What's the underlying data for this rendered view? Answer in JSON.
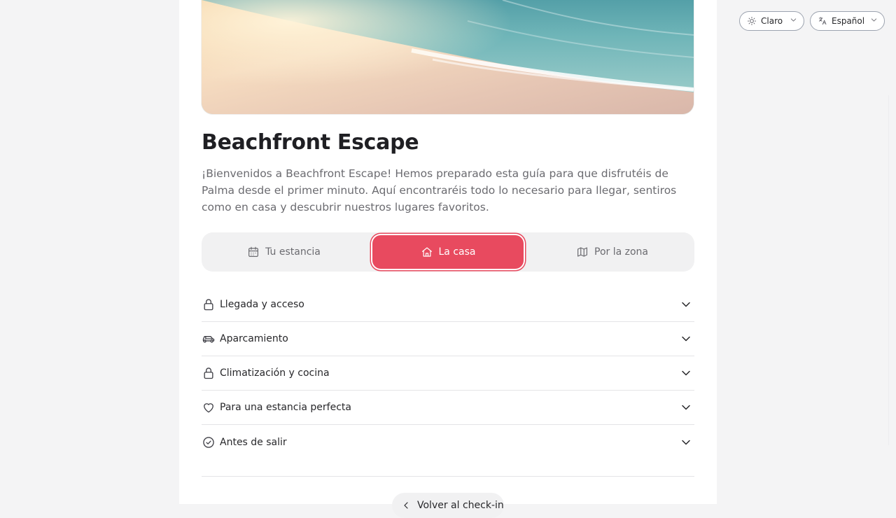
{
  "property": {
    "title": "Beachfront Escape",
    "intro": "¡Bienvenidos a Beachfront Escape! Hemos preparado esta guía para que disfrutéis de Palma desde el primer minuto. Aquí encontraréis todo lo necesario para llegar, sentiros como en casa y descubrir nuestros lugares favoritos."
  },
  "tabs": [
    {
      "label": "Tu estancia",
      "icon": "calendar-icon",
      "active": false
    },
    {
      "label": "La casa",
      "icon": "home-icon",
      "active": true
    },
    {
      "label": "Por la zona",
      "icon": "map-icon",
      "active": false
    }
  ],
  "sections": [
    {
      "label": "Llegada y acceso",
      "icon": "lock-icon"
    },
    {
      "label": "Aparcamiento",
      "icon": "car-icon"
    },
    {
      "label": "Climatización y cocina",
      "icon": "lock-icon"
    },
    {
      "label": "Para una estancia perfecta",
      "icon": "heart-icon"
    },
    {
      "label": "Antes de salir",
      "icon": "check-circle-icon"
    }
  ],
  "footer": {
    "back_label": "Volver al check-in"
  },
  "controls": {
    "theme_label": "Claro",
    "theme_icon": "sun-icon",
    "language_label": "Español",
    "language_icon": "translate-icon"
  },
  "colors": {
    "accent": "#e84a5f",
    "background": "#f4f4f5",
    "card": "#ffffff"
  }
}
